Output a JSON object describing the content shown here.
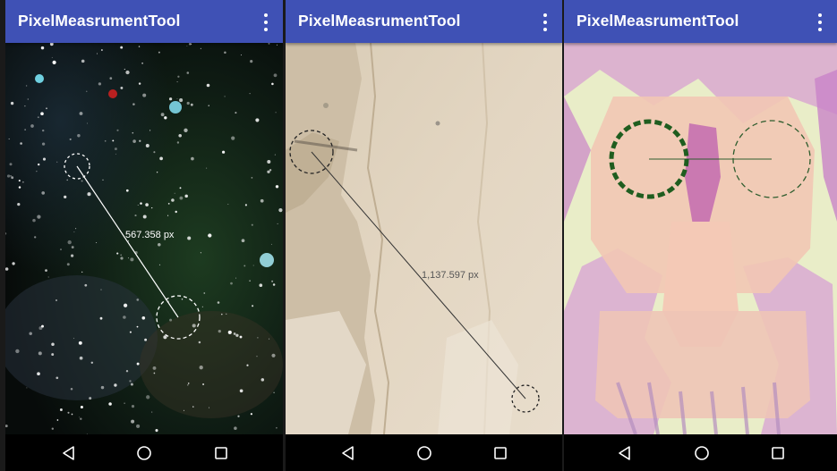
{
  "app": {
    "title": "PixelMeasrumentTool",
    "bar_color": "#3f51b5"
  },
  "icons": {
    "overflow_menu": "more-vert-icon",
    "back": "back-triangle-icon",
    "home": "home-circle-icon",
    "recents": "recents-square-icon"
  },
  "screens": [
    {
      "name": "space-photo",
      "measurement": "567.358 px",
      "label_color": "#ffffff"
    },
    {
      "name": "paper-photo",
      "measurement": "1,137.597 px",
      "label_color": "#555555"
    },
    {
      "name": "skull-art",
      "measurement": "",
      "label_color": "#2e5d2e"
    }
  ]
}
